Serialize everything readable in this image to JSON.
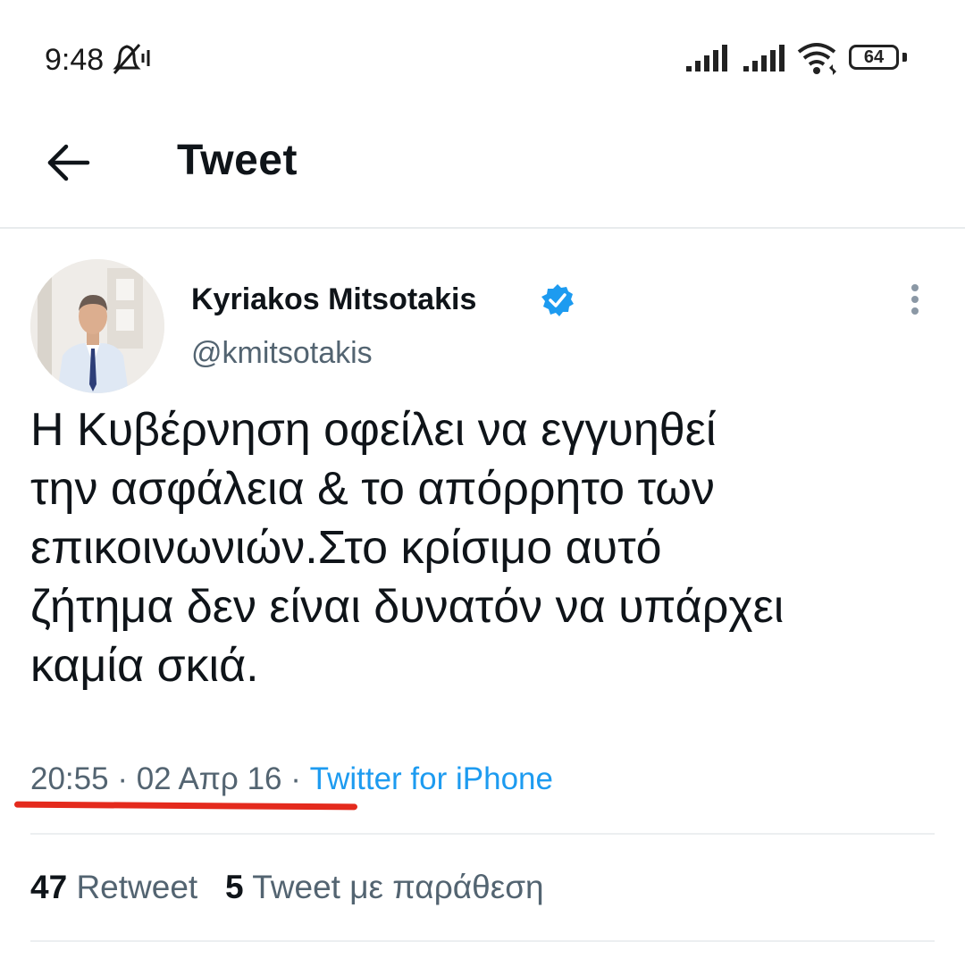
{
  "status_bar": {
    "time": "9:48",
    "battery": "64",
    "icons": [
      "mute-icon",
      "signal-icon",
      "signal-icon",
      "wifi-icon",
      "battery-icon"
    ]
  },
  "header": {
    "back_icon": "arrow-left-icon",
    "title": "Tweet"
  },
  "tweet": {
    "author_name": "Kyriakos Mitsotakis",
    "verified": true,
    "verified_color": "#1d9bf0",
    "handle": "@kmitsotakis",
    "text_lines": [
      "Η Κυβέρνηση οφείλει να εγγυηθεί",
      "την ασφάλεια & το απόρρητο των",
      "επικοινωνιών.Στο κρίσιμο αυτό",
      "ζήτημα δεν είναι δυνατόν να υπάρχει",
      "καμία σκιά."
    ],
    "time": "20:55",
    "separator": "·",
    "date": "02 Απρ 16",
    "source": "Twitter for iPhone",
    "source_color": "#1d9bf0",
    "highlight_color": "#e42a1d"
  },
  "stats": {
    "retweets_count": "47",
    "retweets_label": "Retweet",
    "quotes_count": "5",
    "quotes_label": "Tweet με παράθεση"
  }
}
